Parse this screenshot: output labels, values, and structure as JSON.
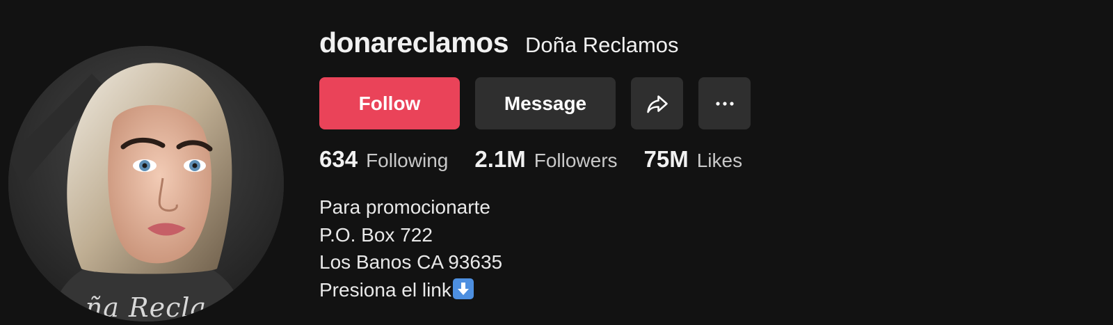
{
  "profile": {
    "username": "donareclamos",
    "nickname": "Doña Reclamos",
    "avatar_caption": "ña Recla"
  },
  "buttons": {
    "follow_label": "Follow",
    "message_label": "Message",
    "share_icon": "share-arrow-icon",
    "more_icon": "more-horizontal-icon"
  },
  "stats": [
    {
      "value": "634",
      "label": "Following"
    },
    {
      "value": "2.1M",
      "label": "Followers"
    },
    {
      "value": "75M",
      "label": "Likes"
    }
  ],
  "bio": {
    "lines": [
      "Para promocionarte",
      "P.O. Box 722",
      "Los Banos CA 93635",
      "Presiona el link"
    ],
    "trailing_emoji": "down-arrow-emoji"
  },
  "colors": {
    "background": "#121212",
    "follow_button": "#ea4359",
    "secondary_button": "#2f2f2f",
    "text_primary": "#f1f1f1",
    "text_secondary": "#c9c9c9",
    "emoji_blue": "#4d8fe0"
  }
}
